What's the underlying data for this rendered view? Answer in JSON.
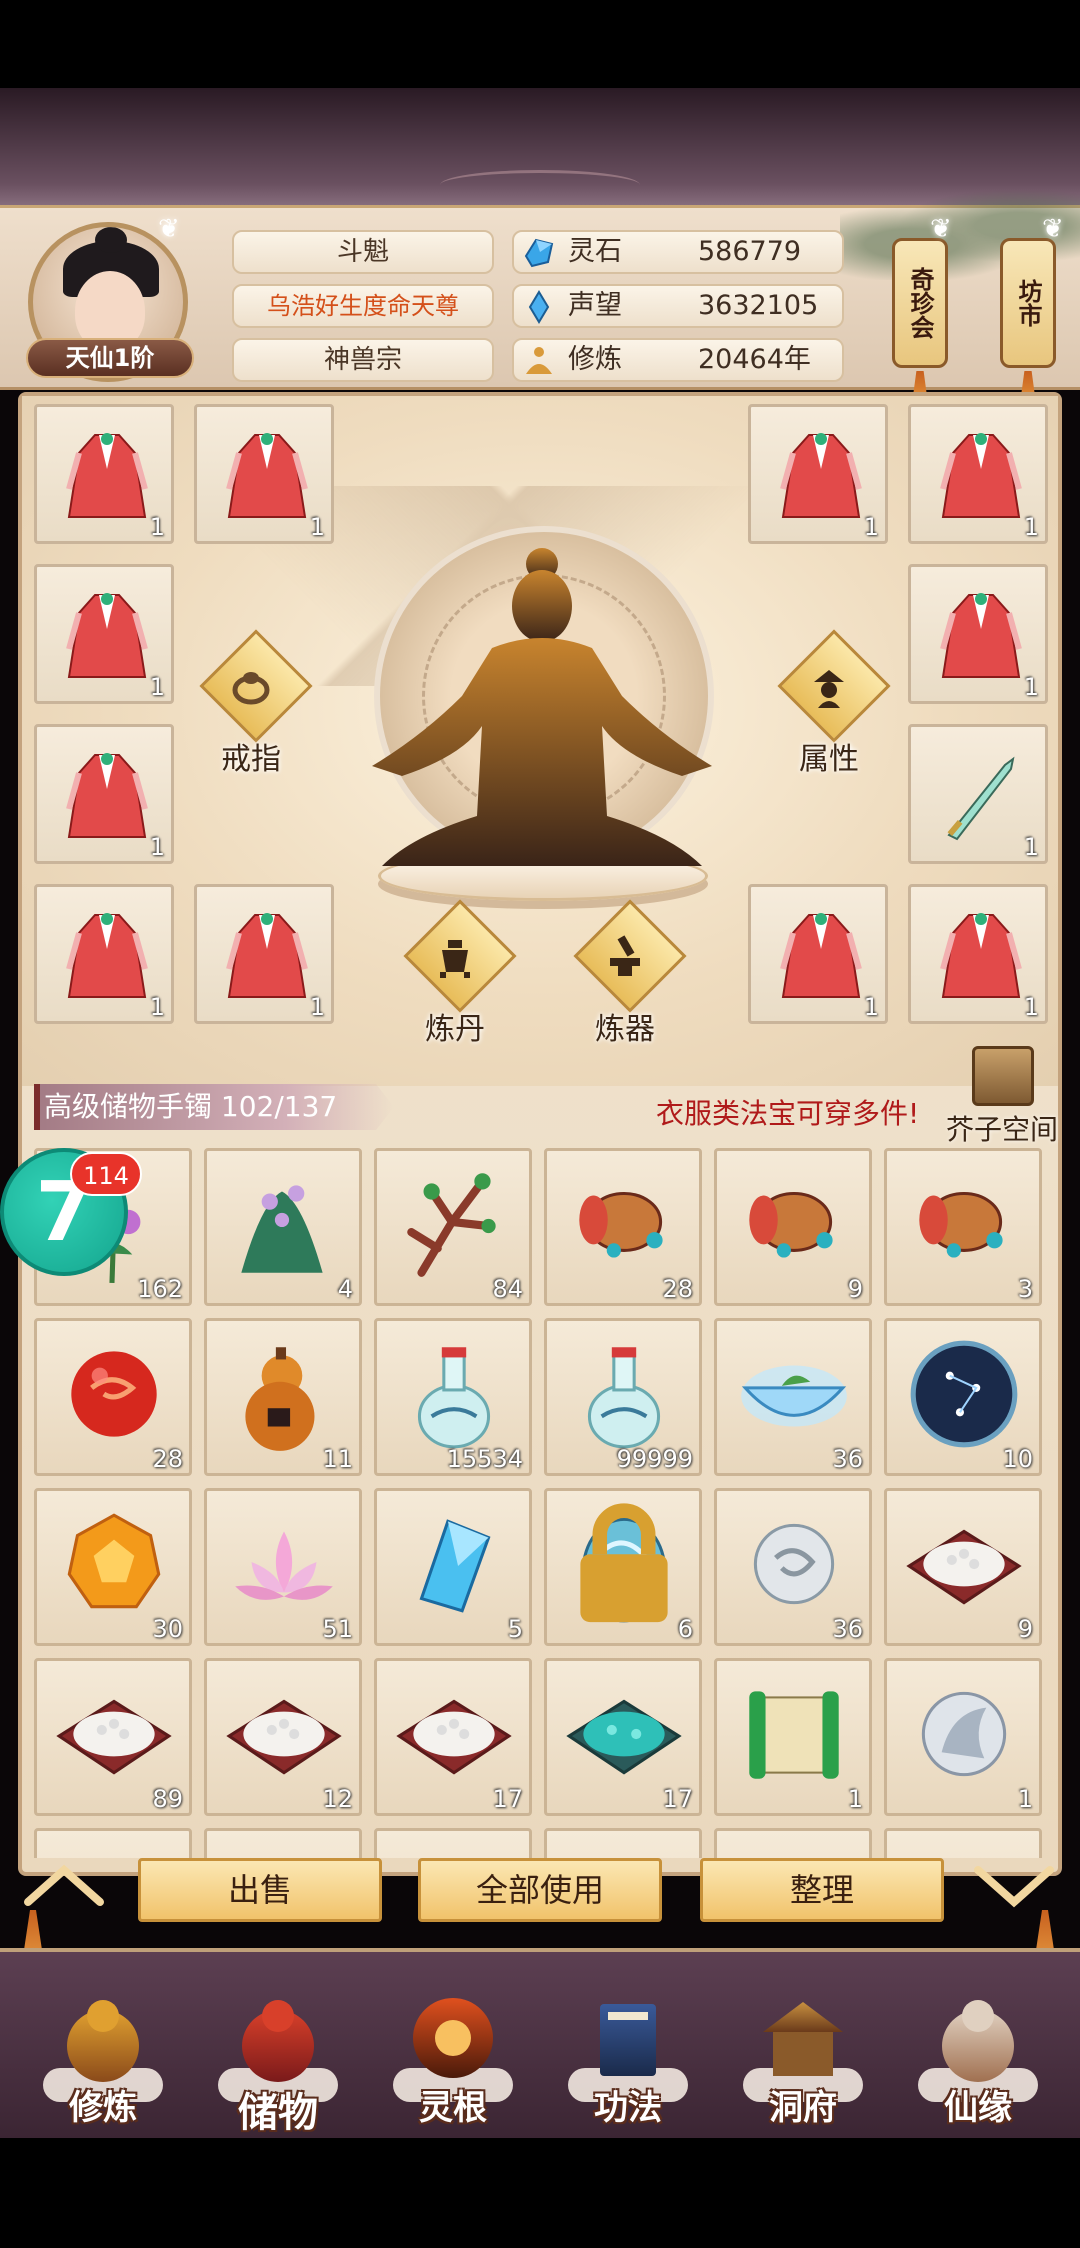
{
  "header": {
    "player_name": "斗魁",
    "title": "乌浩好生度命天尊",
    "sect": "神兽宗",
    "rank": "天仙1阶",
    "stats": [
      {
        "icon": "spirit-stone-icon",
        "label": "灵石",
        "value": "586779"
      },
      {
        "icon": "prestige-crystal-icon",
        "label": "声望",
        "value": "3632105"
      },
      {
        "icon": "cultivation-icon",
        "label": "修炼",
        "value": "20464年"
      }
    ],
    "treasure_pavilion": "奇珍会",
    "market": "坊市"
  },
  "equipment": {
    "slot_counts": [
      "1",
      "1",
      "1",
      "1",
      "1",
      "1",
      "1",
      "1",
      "1",
      "1",
      "1",
      "1"
    ],
    "ring_label": "戒指",
    "attributes_label": "属性",
    "alchemy_label": "炼丹",
    "forge_label": "炼器"
  },
  "bag": {
    "label": "高级储物手镯 102/137",
    "hint": "衣服类法宝可穿多件!",
    "mustard_space": "芥子空间",
    "badge_number": "7",
    "notification_count": "114",
    "items": [
      {
        "name": "purple-herb-icon",
        "count": "162"
      },
      {
        "name": "green-herb-icon",
        "count": "4"
      },
      {
        "name": "red-coral-icon",
        "count": "84"
      },
      {
        "name": "scroll-jar-icon",
        "count": "28"
      },
      {
        "name": "scroll-jar-icon",
        "count": "9"
      },
      {
        "name": "scroll-jar-icon",
        "count": "3"
      },
      {
        "name": "red-orb-icon",
        "count": "28"
      },
      {
        "name": "gourd-icon",
        "count": "11"
      },
      {
        "name": "potion-vase-icon",
        "count": "15534"
      },
      {
        "name": "potion-vase-icon",
        "count": "99999"
      },
      {
        "name": "spirit-bowl-icon",
        "count": "36"
      },
      {
        "name": "star-map-icon",
        "count": "10"
      },
      {
        "name": "amber-gem-icon",
        "count": "30"
      },
      {
        "name": "lotus-icon",
        "count": "51"
      },
      {
        "name": "blue-crystal-icon",
        "count": "5"
      },
      {
        "name": "dragon-egg-icon",
        "count": "6",
        "locked": true
      },
      {
        "name": "silver-orb-icon",
        "count": "36"
      },
      {
        "name": "rice-tray-icon",
        "count": "9"
      },
      {
        "name": "rice-tray-icon",
        "count": "89"
      },
      {
        "name": "rice-tray-icon",
        "count": "12"
      },
      {
        "name": "rice-tray-icon",
        "count": "17"
      },
      {
        "name": "teal-grain-icon",
        "count": "17"
      },
      {
        "name": "green-scroll-icon",
        "count": "1"
      },
      {
        "name": "silver-emblem-icon",
        "count": "1"
      }
    ]
  },
  "actions": {
    "sell": "出售",
    "use_all": "全部使用",
    "sort": "整理"
  },
  "nav": {
    "items": [
      {
        "label": "修炼",
        "icon": "meditation-nav-icon"
      },
      {
        "label": "储物",
        "icon": "storage-bag-nav-icon",
        "active": true
      },
      {
        "label": "灵根",
        "icon": "spirit-root-nav-icon"
      },
      {
        "label": "功法",
        "icon": "technique-book-nav-icon"
      },
      {
        "label": "洞府",
        "icon": "cave-residence-nav-icon"
      },
      {
        "label": "仙缘",
        "icon": "immortal-fate-nav-icon"
      }
    ]
  }
}
